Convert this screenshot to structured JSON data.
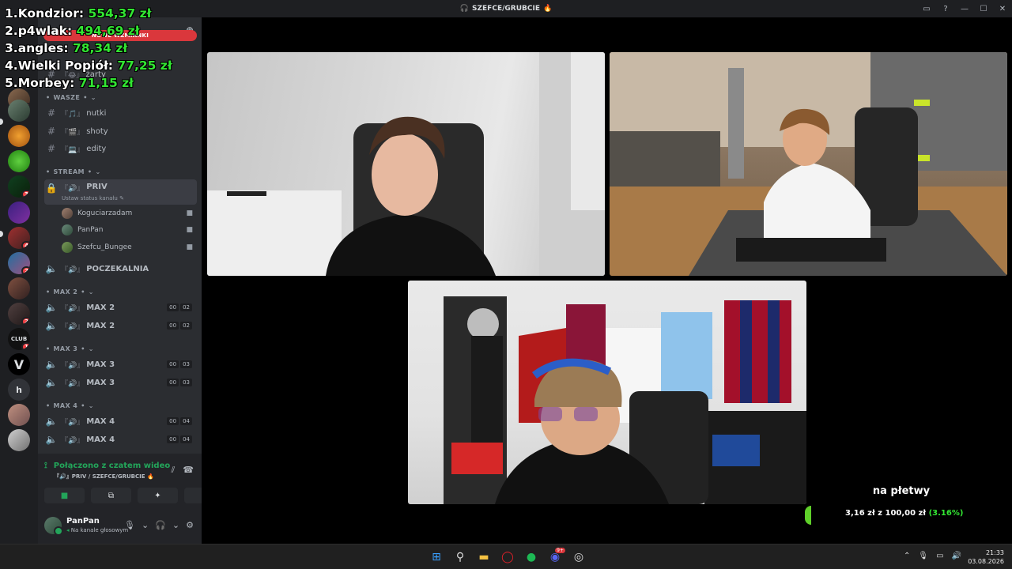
{
  "window": {
    "title": "SZEFCE/GRUBCIE",
    "title_emoji": "🔥"
  },
  "overlay": {
    "leaderboard": [
      {
        "rank": "1.",
        "name": "Kondzior:",
        "amount": "554,37 zł"
      },
      {
        "rank": "2.",
        "name": "p4wlak:",
        "amount": "494,69 zł"
      },
      {
        "rank": "3.",
        "name": "angles:",
        "amount": "78,34 zł"
      },
      {
        "rank": "4.",
        "name": "Wielki Popiół:",
        "amount": "77,25 zł"
      },
      {
        "rank": "5.",
        "name": "Morbey:",
        "amount": "71,15 zł"
      }
    ]
  },
  "rail": {
    "badges": [
      "14",
      "3",
      "4",
      "2",
      "2",
      "1"
    ],
    "club_label": "CLUB",
    "letter_server": "h"
  },
  "sidebar": {
    "mention_banner": "NOWE WZMIANKI",
    "partial_channel": "żarty",
    "categories": {
      "wasze": "WASZE",
      "stream": "STREAM",
      "max2": "MAX 2",
      "max3": "MAX 3",
      "max4": "MAX 4"
    },
    "text_channels": [
      {
        "prefix": "『🎵』",
        "name": "nutki"
      },
      {
        "prefix": "『🎬』",
        "name": "shoty"
      },
      {
        "prefix": "『💻』",
        "name": "edity"
      }
    ],
    "priv": {
      "prefix": "『🔊』",
      "name": "PRIV",
      "status": "Ustaw status kanału"
    },
    "voice_users": [
      "Koguciarzadam",
      "PanPan",
      "Szefcu_Bungee"
    ],
    "poczekalnia": {
      "prefix": "『🔊』",
      "name": "POCZEKALNIA"
    },
    "max_channels": [
      {
        "prefix": "『🔊』",
        "name": "MAX 2",
        "count": "00",
        "limit": "02"
      },
      {
        "prefix": "『🔊』",
        "name": "MAX 2",
        "count": "00",
        "limit": "02"
      },
      {
        "prefix": "『🔊』",
        "name": "MAX 3",
        "count": "00",
        "limit": "03"
      },
      {
        "prefix": "『🔊』",
        "name": "MAX 3",
        "count": "00",
        "limit": "03"
      },
      {
        "prefix": "『🔊』",
        "name": "MAX 4",
        "count": "00",
        "limit": "04"
      },
      {
        "prefix": "『🔊』",
        "name": "MAX 4",
        "count": "00",
        "limit": "04"
      }
    ]
  },
  "voice_panel": {
    "status": "Połączono z czatem wideo",
    "location": "『🔊』PRIV / SZEFCE/GRUBCIE 🔥"
  },
  "user": {
    "name": "PanPan",
    "status": "Na kanale głosowym"
  },
  "goal": {
    "title": "na płetwy",
    "current": "3,16 zł",
    "separator": "z",
    "target": "100,00 zł",
    "percent": "(3.16%)",
    "progress_fraction": 0.0316
  },
  "clock": {
    "time": "21:33",
    "date": "03.08.2026"
  },
  "colors": {
    "accent_green": "#32e632",
    "discord_bg": "#2b2d31",
    "mention_red": "#da373c"
  }
}
